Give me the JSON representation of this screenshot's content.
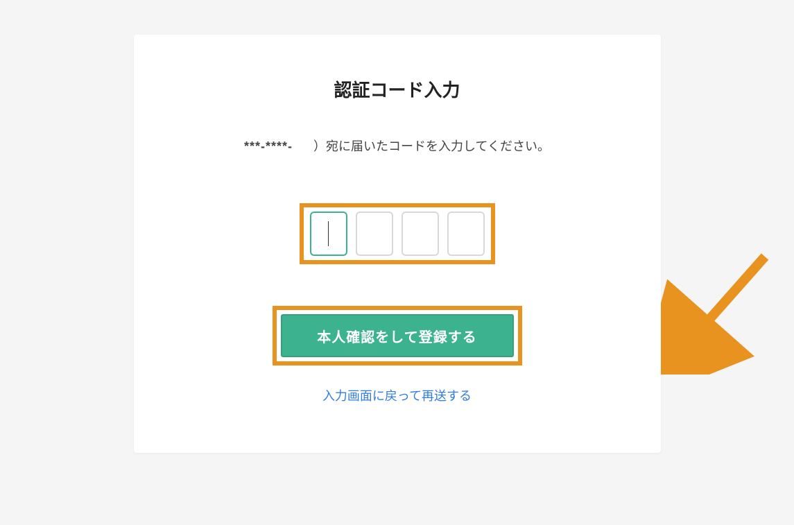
{
  "title": "認証コード入力",
  "instruction": {
    "masked_phone": "***-****-",
    "suffix": "）宛に届いたコードを入力してください。"
  },
  "code_inputs": {
    "count": 4,
    "values": [
      "",
      "",
      "",
      ""
    ],
    "active_index": 0
  },
  "submit": {
    "label": "本人確認をして登録する"
  },
  "resend": {
    "label": "入力画面に戻って再送する"
  },
  "colors": {
    "highlight_border": "#e8931f",
    "primary": "#3cb28e",
    "link": "#2f7de1"
  }
}
